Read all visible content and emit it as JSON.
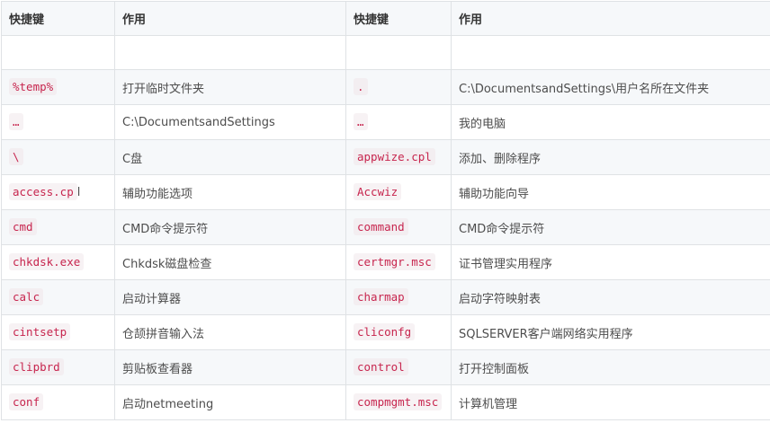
{
  "headers": [
    "快捷键",
    "作用",
    "快捷键",
    "作用"
  ],
  "rows": [
    {
      "k1": "",
      "d1": "",
      "k2": "",
      "d2": ""
    },
    {
      "k1": "%temp%",
      "d1": "打开临时文件夹",
      "k2": ".",
      "d2": "C:\\DocumentsandSettings\\用户名所在文件夹"
    },
    {
      "k1": "…",
      "d1": "C:\\DocumentsandSettings",
      "k2": "…",
      "d2": "我的电脑"
    },
    {
      "k1": "\\",
      "d1": "C盘",
      "k2": "appwize.cpl",
      "d2": "添加、删除程序"
    },
    {
      "k1": "access.cp",
      "k1_tail": "l",
      "d1": "辅助功能选项",
      "k2": "Accwiz",
      "d2": "辅助功能向导"
    },
    {
      "k1": "cmd",
      "d1": "CMD命令提示符",
      "k2": "command",
      "d2": "CMD命令提示符"
    },
    {
      "k1": "chkdsk.exe",
      "d1": "Chkdsk磁盘检查",
      "k2": "certmgr.msc",
      "d2": "证书管理实用程序"
    },
    {
      "k1": "calc",
      "d1": "启动计算器",
      "k2": "charmap",
      "d2": "启动字符映射表"
    },
    {
      "k1": "cintsetp",
      "d1": "仓颉拼音输入法",
      "k2": "cliconfg",
      "d2": "SQLSERVER客户端网络实用程序"
    },
    {
      "k1": "clipbrd",
      "d1": "剪贴板查看器",
      "k2": "control",
      "d2": "打开控制面板"
    },
    {
      "k1": "conf",
      "d1": "启动netmeeting",
      "k2": "compmgmt.msc",
      "d2": "计算机管理"
    }
  ]
}
